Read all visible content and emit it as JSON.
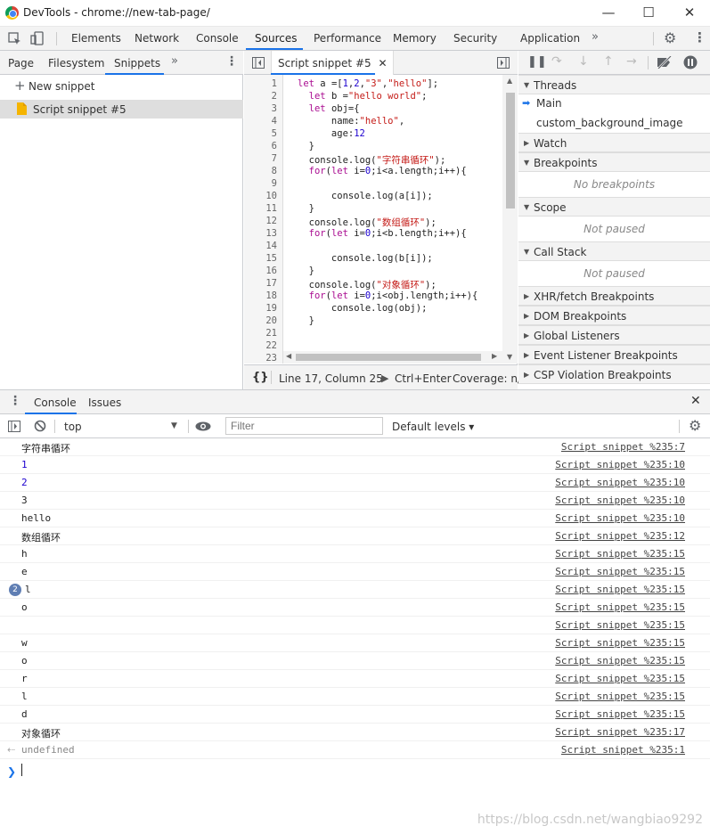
{
  "window": {
    "title": "DevTools - chrome://new-tab-page/",
    "minimize": "—",
    "maximize": "☐",
    "close": "✕"
  },
  "main_tabs": [
    "Elements",
    "Network",
    "Console",
    "Sources",
    "Performance",
    "Memory",
    "Security",
    "Application"
  ],
  "nav_tabs": [
    "Page",
    "Filesystem",
    "Snippets"
  ],
  "new_snippet": "New snippet",
  "snippet_item": "Script snippet #5",
  "editor_tab": "Script snippet #5",
  "line_numbers": [
    "1",
    "2",
    "3",
    "4",
    "5",
    "6",
    "7",
    "8",
    "9",
    "10",
    "11",
    "12",
    "13",
    "14",
    "15",
    "16",
    "17",
    "18",
    "19",
    "20",
    "21",
    "22",
    "23"
  ],
  "code": [
    [
      [
        "kw",
        "let "
      ],
      [
        "cn",
        "a =["
      ],
      [
        "num",
        "1"
      ],
      [
        "cn",
        ","
      ],
      [
        "num",
        "2"
      ],
      [
        "cn",
        ","
      ],
      [
        "str",
        "\"3\""
      ],
      [
        "cn",
        ","
      ],
      [
        "str",
        "\"hello\""
      ],
      [
        "cn",
        "];"
      ]
    ],
    [
      [
        "cn",
        "  "
      ],
      [
        "kw",
        "let "
      ],
      [
        "cn",
        "b ="
      ],
      [
        "str",
        "\"hello world\""
      ],
      [
        "cn",
        ";"
      ]
    ],
    [
      [
        "cn",
        "  "
      ],
      [
        "kw",
        "let "
      ],
      [
        "cn",
        "obj={"
      ]
    ],
    [
      [
        "cn",
        "      name:"
      ],
      [
        "str",
        "\"hello\""
      ],
      [
        "cn",
        ","
      ]
    ],
    [
      [
        "cn",
        "      age:"
      ],
      [
        "num",
        "12"
      ]
    ],
    [
      [
        "cn",
        "  }"
      ]
    ],
    [
      [
        "cn",
        "  console.log("
      ],
      [
        "str",
        "\"字符串循环\""
      ],
      [
        "cn",
        ");"
      ]
    ],
    [
      [
        "cn",
        "  "
      ],
      [
        "kw",
        "for"
      ],
      [
        "cn",
        "("
      ],
      [
        "kw",
        "let "
      ],
      [
        "cn",
        "i="
      ],
      [
        "num",
        "0"
      ],
      [
        "cn",
        ";i<a.length;i++){"
      ]
    ],
    [
      [
        "cn",
        ""
      ]
    ],
    [
      [
        "cn",
        "      console.log(a[i]);"
      ]
    ],
    [
      [
        "cn",
        "  }"
      ]
    ],
    [
      [
        "cn",
        "  console.log("
      ],
      [
        "str",
        "\"数组循环\""
      ],
      [
        "cn",
        ");"
      ]
    ],
    [
      [
        "cn",
        "  "
      ],
      [
        "kw",
        "for"
      ],
      [
        "cn",
        "("
      ],
      [
        "kw",
        "let "
      ],
      [
        "cn",
        "i="
      ],
      [
        "num",
        "0"
      ],
      [
        "cn",
        ";i<b.length;i++){"
      ]
    ],
    [
      [
        "cn",
        ""
      ]
    ],
    [
      [
        "cn",
        "      console.log(b[i]);"
      ]
    ],
    [
      [
        "cn",
        "  }"
      ]
    ],
    [
      [
        "cn",
        "  console.log("
      ],
      [
        "str",
        "\"对象循环\""
      ],
      [
        "cn",
        ");"
      ]
    ],
    [
      [
        "cn",
        "  "
      ],
      [
        "kw",
        "for"
      ],
      [
        "cn",
        "("
      ],
      [
        "kw",
        "let "
      ],
      [
        "cn",
        "i="
      ],
      [
        "num",
        "0"
      ],
      [
        "cn",
        ";i<obj.length;i++){"
      ]
    ],
    [
      [
        "cn",
        "      console.log(obj);"
      ]
    ],
    [
      [
        "cn",
        "  }"
      ]
    ],
    [
      [
        "cn",
        ""
      ]
    ],
    [
      [
        "cn",
        ""
      ]
    ],
    [
      [
        "cn",
        ""
      ]
    ]
  ],
  "status": {
    "braces": "{}",
    "position": "Line 17, Column 25",
    "run_hint": "Ctrl+Enter",
    "coverage": "Coverage: n/"
  },
  "debugger": {
    "threads": "Threads",
    "main": "Main",
    "custom_bg": "custom_background_image",
    "watch": "Watch",
    "breakpoints": "Breakpoints",
    "no_breakpoints": "No breakpoints",
    "scope": "Scope",
    "not_paused_1": "Not paused",
    "call_stack": "Call Stack",
    "not_paused_2": "Not paused",
    "xhr": "XHR/fetch Breakpoints",
    "dom": "DOM Breakpoints",
    "global": "Global Listeners",
    "event": "Event Listener Breakpoints",
    "csp": "CSP Violation Breakpoints"
  },
  "drawer_tabs": [
    "Console",
    "Issues"
  ],
  "console_toolbar": {
    "context": "top",
    "filter_placeholder": "Filter",
    "levels": "Default levels ▾"
  },
  "console_rows": [
    {
      "msg": "字符串循环",
      "src": "Script snippet %235:7",
      "kind": "text"
    },
    {
      "msg": "1",
      "src": "Script snippet %235:10",
      "kind": "num"
    },
    {
      "msg": "2",
      "src": "Script snippet %235:10",
      "kind": "num"
    },
    {
      "msg": "3",
      "src": "Script snippet %235:10",
      "kind": "text"
    },
    {
      "msg": "hello",
      "src": "Script snippet %235:10",
      "kind": "text"
    },
    {
      "msg": "数组循环",
      "src": "Script snippet %235:12",
      "kind": "text"
    },
    {
      "msg": "h",
      "src": "Script snippet %235:15",
      "kind": "text"
    },
    {
      "msg": "e",
      "src": "Script snippet %235:15",
      "kind": "text"
    },
    {
      "msg": "l",
      "src": "Script snippet %235:15",
      "kind": "text",
      "badge": "2"
    },
    {
      "msg": "o",
      "src": "Script snippet %235:15",
      "kind": "text"
    },
    {
      "msg": "",
      "src": "Script snippet %235:15",
      "kind": "text"
    },
    {
      "msg": "w",
      "src": "Script snippet %235:15",
      "kind": "text"
    },
    {
      "msg": "o",
      "src": "Script snippet %235:15",
      "kind": "text"
    },
    {
      "msg": "r",
      "src": "Script snippet %235:15",
      "kind": "text"
    },
    {
      "msg": "l",
      "src": "Script snippet %235:15",
      "kind": "text"
    },
    {
      "msg": "d",
      "src": "Script snippet %235:15",
      "kind": "text"
    },
    {
      "msg": "对象循环",
      "src": "Script snippet %235:17",
      "kind": "text"
    },
    {
      "msg": "undefined",
      "src": "Script snippet %235:1",
      "kind": "undef"
    }
  ],
  "watermark": "https://blog.csdn.net/wangbiao9292"
}
